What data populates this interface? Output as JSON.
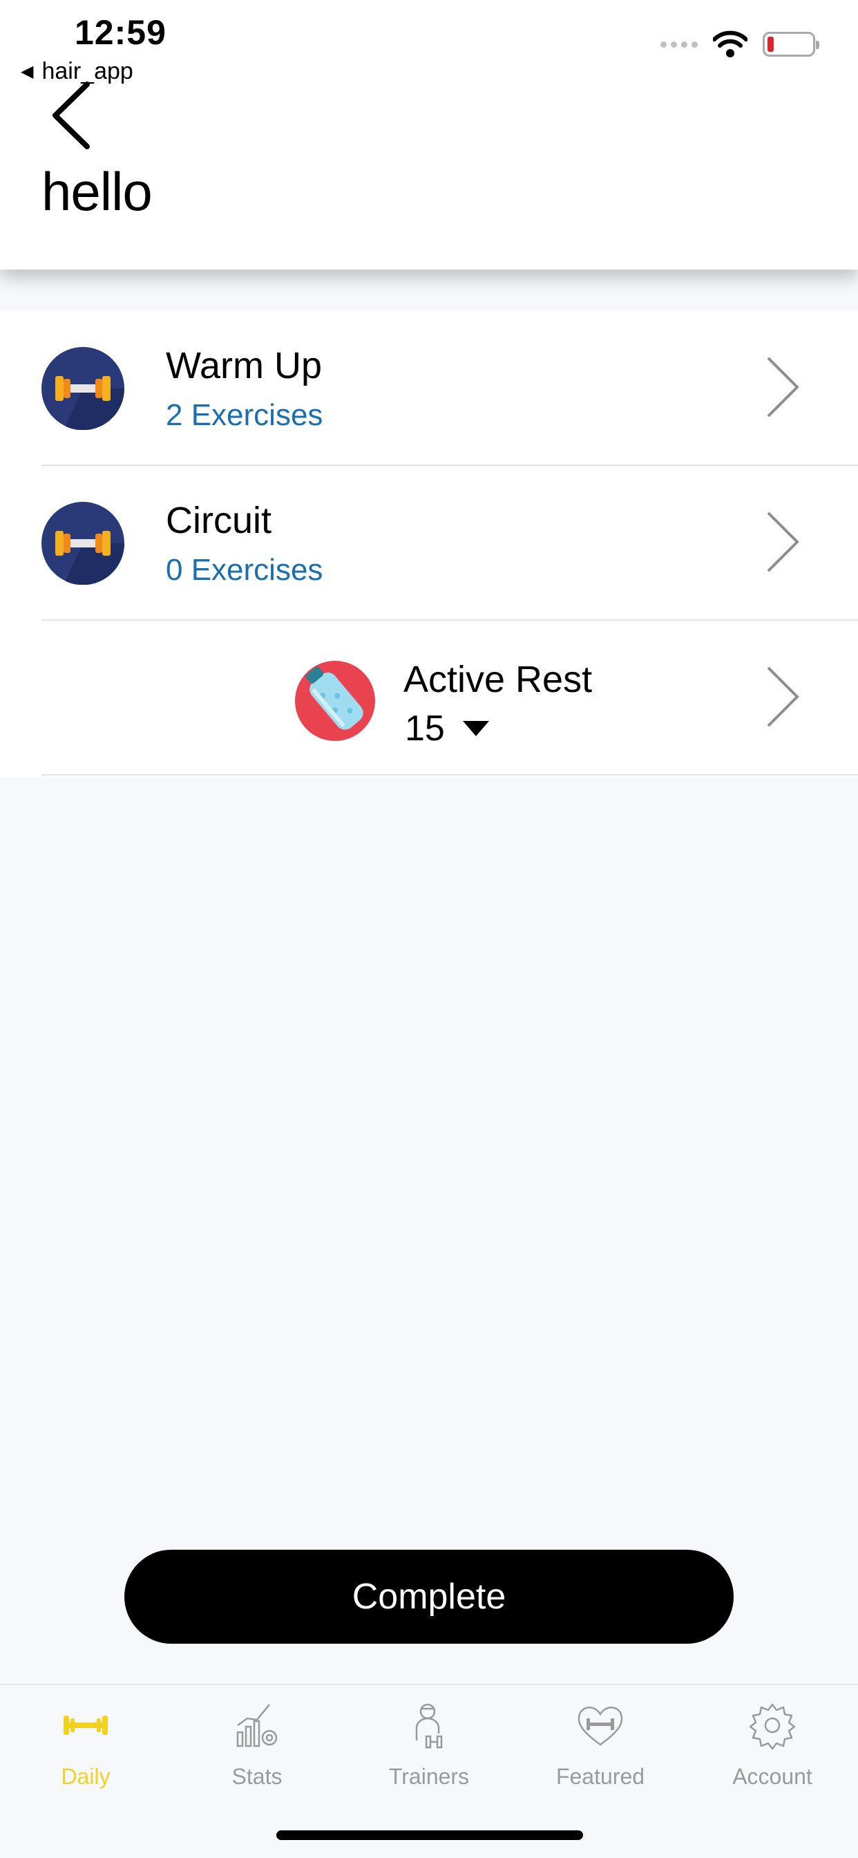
{
  "status_bar": {
    "time": "12:59",
    "back_app": "hair_app",
    "battery_color": "#e0262b"
  },
  "header": {
    "back_icon": "chevron-left-icon",
    "title": "hello"
  },
  "sections": [
    {
      "title": "Warm Up",
      "subtitle": "2 Exercises",
      "icon": "dumbbell-icon"
    },
    {
      "title": "Circuit",
      "subtitle": "0 Exercises",
      "icon": "dumbbell-icon"
    },
    {
      "title": "Active Rest",
      "value": "15",
      "icon": "water-bottle-icon"
    }
  ],
  "complete_button": {
    "label": "Complete"
  },
  "tabbar": {
    "active_color": "#f2d21f",
    "inactive_color": "#9a9a9a",
    "tabs": [
      {
        "label": "Daily",
        "icon": "dumbbell-icon",
        "active": true
      },
      {
        "label": "Stats",
        "icon": "chart-target-icon",
        "active": false
      },
      {
        "label": "Trainers",
        "icon": "trainer-icon",
        "active": false
      },
      {
        "label": "Featured",
        "icon": "heart-dumbbell-icon",
        "active": false
      },
      {
        "label": "Account",
        "icon": "gear-icon",
        "active": false
      }
    ]
  }
}
